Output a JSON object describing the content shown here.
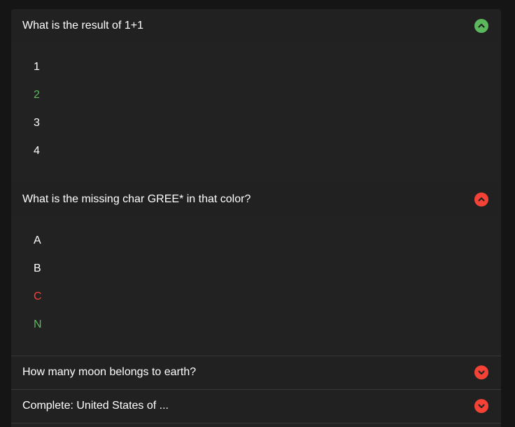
{
  "questions": [
    {
      "title": "What is the result of 1+1",
      "state": "expanded",
      "status": "correct",
      "answers": [
        {
          "label": "1",
          "color": "#ffffff"
        },
        {
          "label": "2",
          "color": "#5cb85c"
        },
        {
          "label": "3",
          "color": "#ffffff"
        },
        {
          "label": "4",
          "color": "#ffffff"
        }
      ]
    },
    {
      "title": "What is the missing char GREE* in that color?",
      "state": "expanded",
      "status": "wrong",
      "answers": [
        {
          "label": "A",
          "color": "#ffffff"
        },
        {
          "label": "B",
          "color": "#ffffff"
        },
        {
          "label": "C",
          "color": "#f44336"
        },
        {
          "label": "N",
          "color": "#5cb85c"
        }
      ]
    },
    {
      "title": "How many moon belongs to earth?",
      "state": "collapsed",
      "status": "wrong"
    },
    {
      "title": "Complete: United States of ...",
      "state": "collapsed",
      "status": "wrong"
    }
  ],
  "colors": {
    "correct": "#5cb85c",
    "wrong": "#f44336",
    "background": "#151515",
    "panel": "#222222",
    "text": "#ffffff"
  },
  "icons": {
    "expanded": "chevron-up-icon",
    "collapsed": "chevron-down-icon"
  }
}
